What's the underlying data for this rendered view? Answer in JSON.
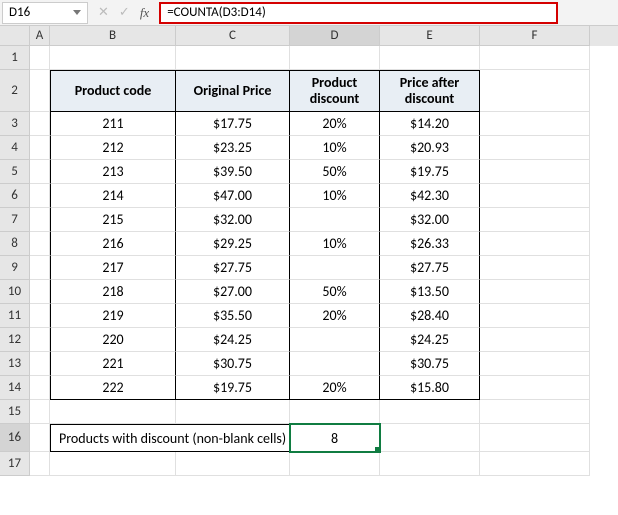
{
  "nameBox": "D16",
  "formula": "=COUNTA(D3:D14)",
  "columns": [
    "A",
    "B",
    "C",
    "D",
    "E",
    "F"
  ],
  "activeCol": "D",
  "activeRow": 16,
  "headers": {
    "B": "Product code",
    "C": "Original Price",
    "D": "Product discount",
    "E": "Price after discount"
  },
  "rows": [
    {
      "n": 3,
      "B": "211",
      "C": "$17.75",
      "D": "20%",
      "E": "$14.20"
    },
    {
      "n": 4,
      "B": "212",
      "C": "$23.25",
      "D": "10%",
      "E": "$20.93"
    },
    {
      "n": 5,
      "B": "213",
      "C": "$39.50",
      "D": "50%",
      "E": "$19.75"
    },
    {
      "n": 6,
      "B": "214",
      "C": "$47.00",
      "D": "10%",
      "E": "$42.30"
    },
    {
      "n": 7,
      "B": "215",
      "C": "$32.00",
      "D": "",
      "E": "$32.00"
    },
    {
      "n": 8,
      "B": "216",
      "C": "$29.25",
      "D": "10%",
      "E": "$26.33"
    },
    {
      "n": 9,
      "B": "217",
      "C": "$27.75",
      "D": "",
      "E": "$27.75"
    },
    {
      "n": 10,
      "B": "218",
      "C": "$27.00",
      "D": "50%",
      "E": "$13.50"
    },
    {
      "n": 11,
      "B": "219",
      "C": "$35.50",
      "D": "20%",
      "E": "$28.40"
    },
    {
      "n": 12,
      "B": "220",
      "C": "$24.25",
      "D": "",
      "E": "$24.25"
    },
    {
      "n": 13,
      "B": "221",
      "C": "$30.75",
      "D": "",
      "E": "$30.75"
    },
    {
      "n": 14,
      "B": "222",
      "C": "$19.75",
      "D": "20%",
      "E": "$15.80"
    }
  ],
  "summaryLabel": "Products with discount (non-blank cells)",
  "summaryValue": "8",
  "chart_data": {
    "type": "table",
    "title": "Products with discount (non-blank cells)",
    "columns": [
      "Product code",
      "Original Price",
      "Product discount",
      "Price after discount"
    ],
    "data": [
      [
        211,
        17.75,
        0.2,
        14.2
      ],
      [
        212,
        23.25,
        0.1,
        20.93
      ],
      [
        213,
        39.5,
        0.5,
        19.75
      ],
      [
        214,
        47.0,
        0.1,
        42.3
      ],
      [
        215,
        32.0,
        null,
        32.0
      ],
      [
        216,
        29.25,
        0.1,
        26.33
      ],
      [
        217,
        27.75,
        null,
        27.75
      ],
      [
        218,
        27.0,
        0.5,
        13.5
      ],
      [
        219,
        35.5,
        0.2,
        28.4
      ],
      [
        220,
        24.25,
        null,
        24.25
      ],
      [
        221,
        30.75,
        null,
        30.75
      ],
      [
        222,
        19.75,
        0.2,
        15.8
      ]
    ],
    "summary": {
      "label": "Products with discount (non-blank cells)",
      "value": 8,
      "formula": "=COUNTA(D3:D14)"
    }
  }
}
